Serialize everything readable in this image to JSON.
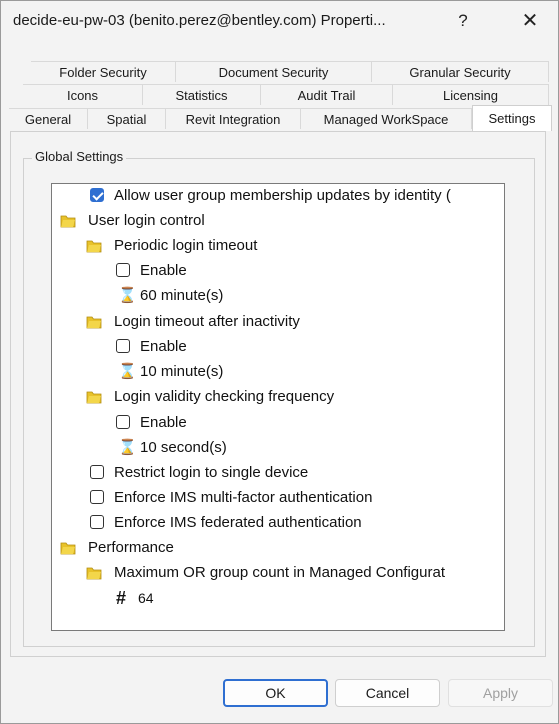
{
  "window": {
    "title": "decide-eu-pw-03 (benito.perez@bentley.com) Properti...",
    "help_label": "?",
    "close_label": "✕"
  },
  "tabs": {
    "row1": [
      "Folder Security",
      "Document Security",
      "Granular Security"
    ],
    "row2": [
      "Icons",
      "Statistics",
      "Audit Trail",
      "Licensing"
    ],
    "row3": [
      "General",
      "Spatial",
      "Revit Integration",
      "Managed WorkSpace",
      "Settings"
    ],
    "active": "Settings"
  },
  "group": {
    "title": "Global Settings"
  },
  "tree": [
    {
      "type": "checkbox",
      "checked": true,
      "label": "Allow user group membership updates by identity ("
    },
    {
      "type": "folder",
      "label": "User login control"
    },
    {
      "type": "folder",
      "label": "Periodic login timeout"
    },
    {
      "type": "checkbox",
      "checked": false,
      "label": "Enable"
    },
    {
      "type": "timer",
      "label": "60 minute(s)"
    },
    {
      "type": "folder",
      "label": "Login timeout after inactivity"
    },
    {
      "type": "checkbox",
      "checked": false,
      "label": "Enable"
    },
    {
      "type": "timer",
      "label": "10 minute(s)"
    },
    {
      "type": "folder",
      "label": "Login validity checking frequency"
    },
    {
      "type": "checkbox",
      "checked": false,
      "label": "Enable"
    },
    {
      "type": "timer",
      "label": "10 second(s)"
    },
    {
      "type": "checkbox",
      "checked": false,
      "label": "Restrict login to single device"
    },
    {
      "type": "checkbox",
      "checked": false,
      "label": "Enforce IMS multi-factor authentication"
    },
    {
      "type": "checkbox",
      "checked": false,
      "label": "Enforce IMS federated authentication"
    },
    {
      "type": "folder",
      "label": "Performance"
    },
    {
      "type": "folder",
      "label": "Maximum OR group count in Managed Configurat"
    },
    {
      "type": "number",
      "label": "64"
    }
  ],
  "icons": {
    "folder": "folder-icon",
    "timer": "hourglass-icon",
    "number": "hash-icon"
  },
  "colors": {
    "accent": "#2f6fd1",
    "folder": "#e8c22a"
  },
  "buttons": {
    "ok": "OK",
    "cancel": "Cancel",
    "apply": "Apply"
  }
}
